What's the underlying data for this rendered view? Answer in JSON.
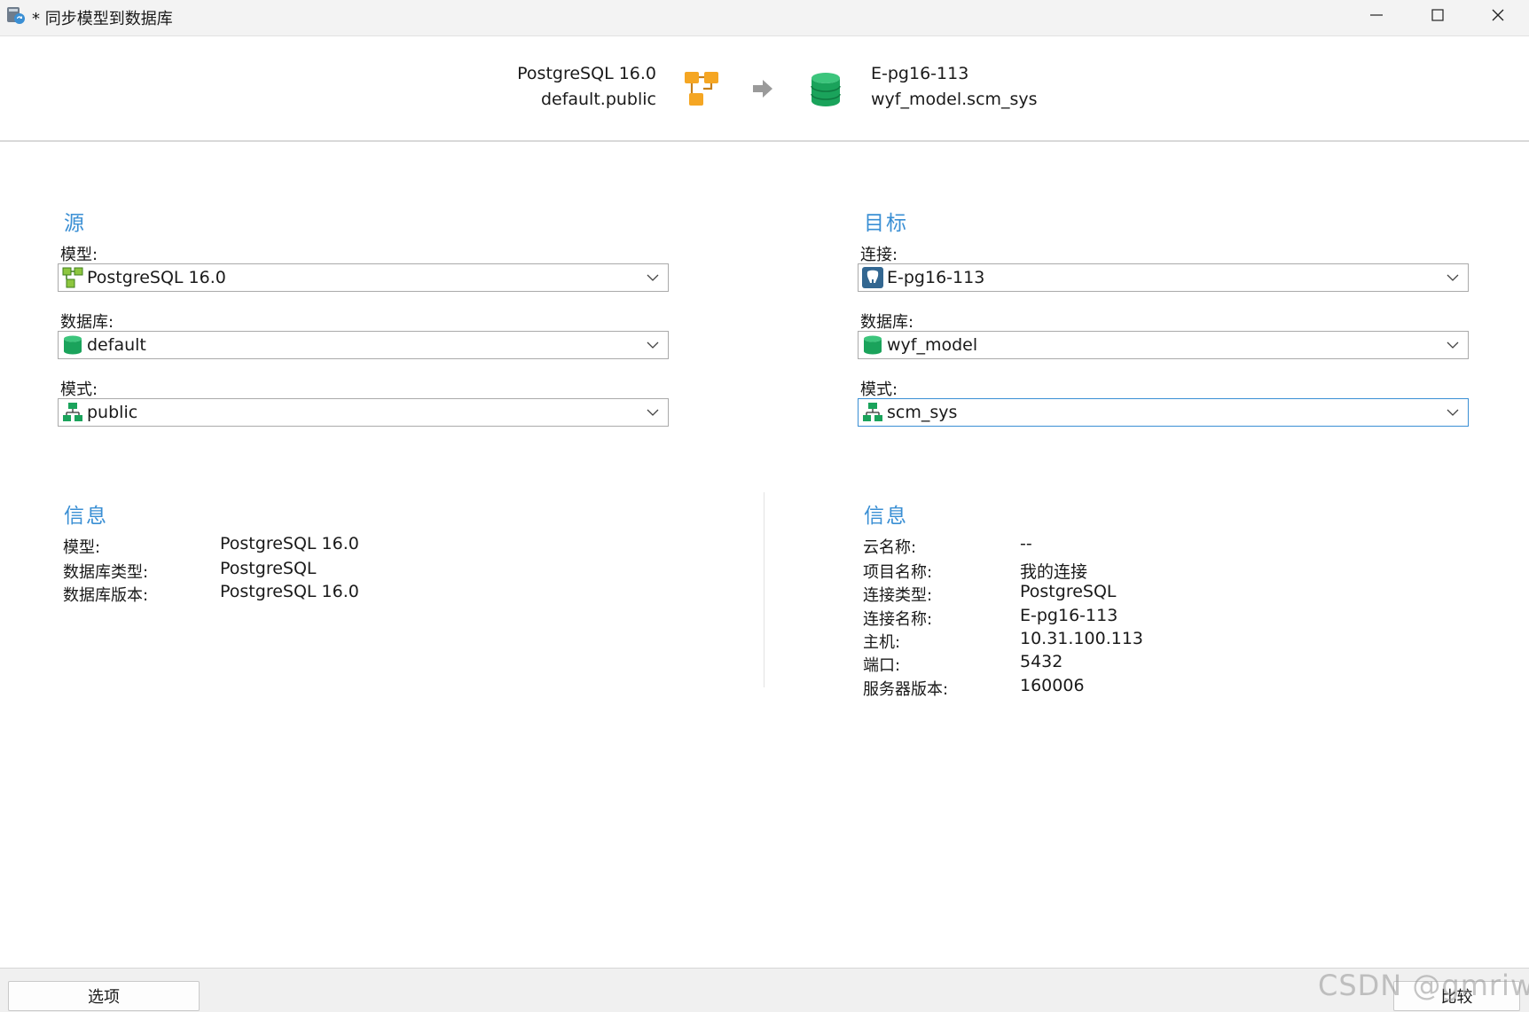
{
  "window": {
    "title": "* 同步模型到数据库"
  },
  "header": {
    "source_line1": "PostgreSQL 16.0",
    "source_line2": "default.public",
    "target_line1": "E-pg16-113",
    "target_line2": "wyf_model.scm_sys"
  },
  "source": {
    "section_title": "源",
    "model_label": "模型:",
    "model_value": "PostgreSQL 16.0",
    "database_label": "数据库:",
    "database_value": "default",
    "schema_label": "模式:",
    "schema_value": "public"
  },
  "target": {
    "section_title": "目标",
    "connection_label": "连接:",
    "connection_value": "E-pg16-113",
    "database_label": "数据库:",
    "database_value": "wyf_model",
    "schema_label": "模式:",
    "schema_value": "scm_sys"
  },
  "source_info": {
    "section_title": "信息",
    "rows": [
      {
        "label": "模型:",
        "value": "PostgreSQL 16.0"
      },
      {
        "label": "数据库类型:",
        "value": "PostgreSQL"
      },
      {
        "label": "数据库版本:",
        "value": "PostgreSQL 16.0"
      }
    ]
  },
  "target_info": {
    "section_title": "信息",
    "rows": [
      {
        "label": "云名称:",
        "value": "--"
      },
      {
        "label": "项目名称:",
        "value": "我的连接"
      },
      {
        "label": "连接类型:",
        "value": "PostgreSQL"
      },
      {
        "label": "连接名称:",
        "value": "E-pg16-113"
      },
      {
        "label": "主机:",
        "value": "10.31.100.113"
      },
      {
        "label": "端口:",
        "value": "5432"
      },
      {
        "label": "服务器版本:",
        "value": "160006"
      }
    ]
  },
  "footer": {
    "options_label": "选项",
    "compare_label": "比较",
    "watermark": "CSDN @gmriwyf"
  },
  "colors": {
    "accent": "#3a8fd4",
    "db_green": "#1aa35b",
    "model_orange": "#f5a623"
  }
}
